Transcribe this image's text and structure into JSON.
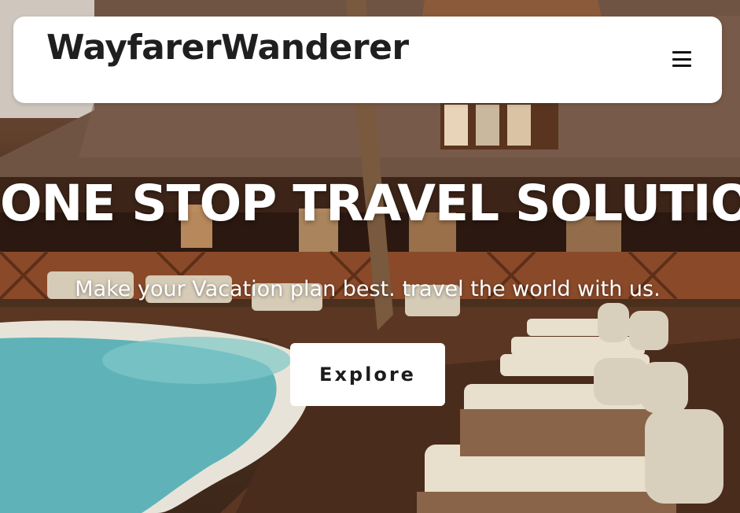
{
  "navbar": {
    "brand": "WayfarerWanderer",
    "menu_icon": "hamburger-menu-icon"
  },
  "hero": {
    "title": "ONE STOP TRAVEL SOLUTION",
    "subtitle": "Make your Vacation plan best. travel the world with us.",
    "cta_label": "Explore"
  }
}
